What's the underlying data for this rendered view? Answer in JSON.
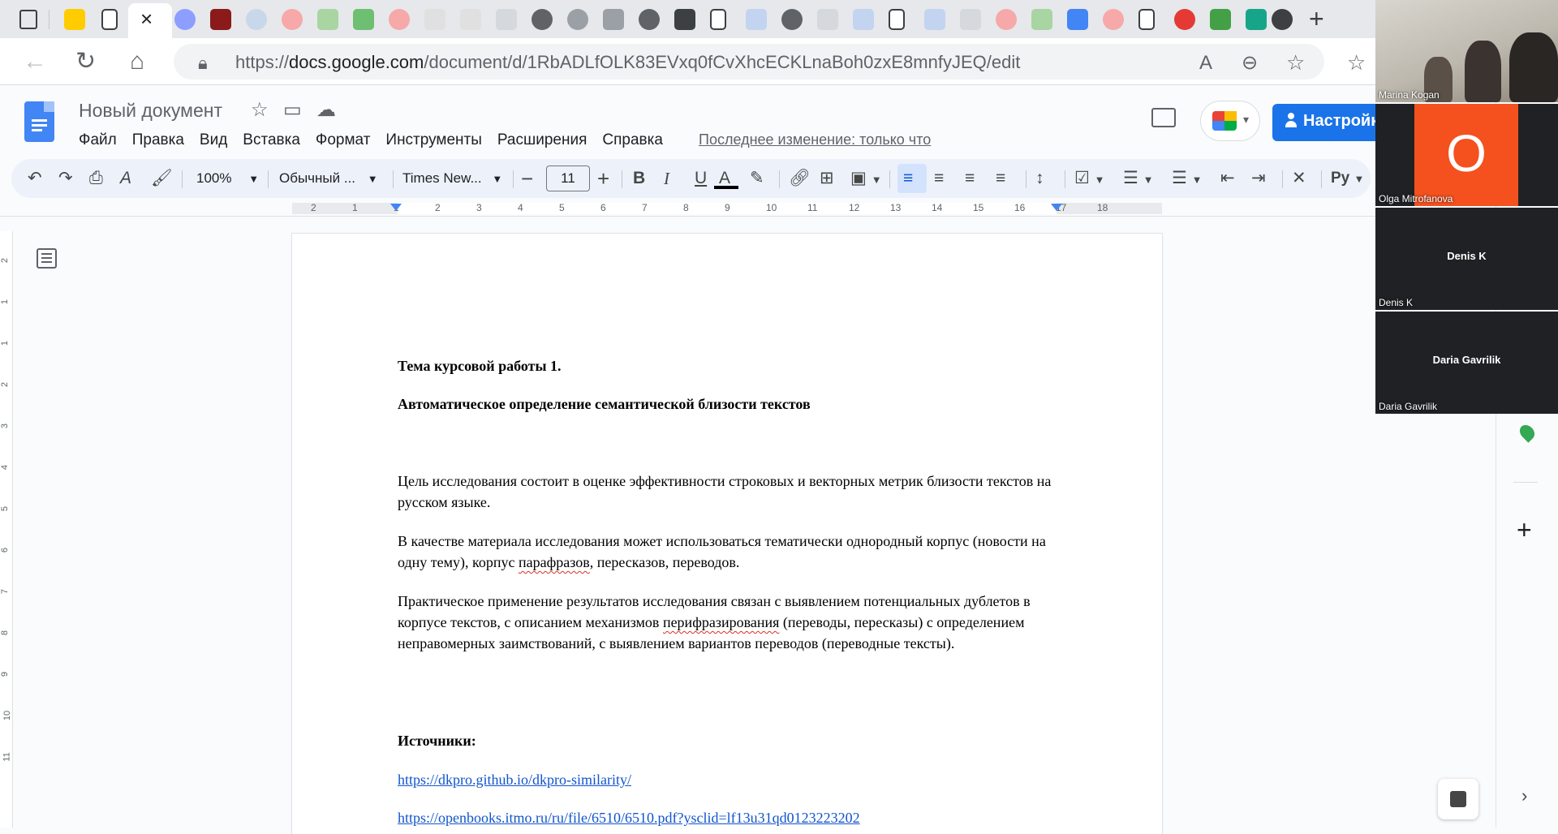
{
  "browser": {
    "url_prefix": "https://",
    "url_domain": "docs.google.com",
    "url_path": "/document/d/1RbADLfOLK83EVxq0fCvXhcECKLnaBoh0zxE8mnfyJEQ/edit",
    "tab_count_icons": 37
  },
  "docs": {
    "title": "Новый документ",
    "menu": [
      "Файл",
      "Правка",
      "Вид",
      "Вставка",
      "Формат",
      "Инструменты",
      "Расширения",
      "Справка"
    ],
    "last_edit": "Последнее изменение: только что",
    "share_label": "Настройки",
    "toolbar": {
      "zoom": "100%",
      "style": "Обычный ...",
      "font": "Times New...",
      "font_size": "11",
      "input_tools": "Ру"
    },
    "ruler_labels": [
      "2",
      "1",
      "1",
      "2",
      "3",
      "4",
      "5",
      "6",
      "7",
      "8",
      "9",
      "10",
      "11",
      "12",
      "13",
      "14",
      "15",
      "16",
      "17",
      "18"
    ],
    "vruler_labels": [
      "2",
      "1",
      "1",
      "2",
      "3",
      "4",
      "5",
      "6",
      "7",
      "8",
      "9",
      "10",
      "11"
    ]
  },
  "document": {
    "heading1": "Тема курсовой работы 1.",
    "heading2": "Автоматическое определение семантической близости текстов",
    "para1": "Цель исследования состоит в оценке эффективности строковых и векторных метрик близости текстов на русском языке.",
    "para2_a": "В качестве материала исследования может использоваться тематически однородный корпус (новости на одну тему), корпус ",
    "para2_err": "парафразов",
    "para2_b": ", пересказов, переводов.",
    "para3_a": "Практическое применение результатов исследования связан с выявлением потенциальных дублетов в корпусе текстов, с описанием механизмов ",
    "para3_err": "перифразирования",
    "para3_b": " (переводы, пересказы) с определением неправомерных заимствований, с выявлением вариантов переводов (переводные тексты).",
    "sources_heading": "Источники:",
    "link1": "https://dkpro.github.io/dkpro-similarity/",
    "link2": "https://openbooks.itmo.ru/ru/file/6510/6510.pdf?ysclid=lf13u31qd0123223202"
  },
  "participants": [
    {
      "name": "Marina Kogan",
      "type": "camera"
    },
    {
      "name": "Olga Mitrofanova",
      "initial": "O",
      "type": "avatar",
      "color": "#f4511e"
    },
    {
      "name": "Denis K",
      "type": "name"
    },
    {
      "name": "Daria Gavrilik",
      "type": "name"
    }
  ],
  "colors": {
    "accent": "#1a73e8",
    "docs_blue": "#4285f4",
    "link": "#1155cc",
    "spell_error": "#d93025"
  }
}
